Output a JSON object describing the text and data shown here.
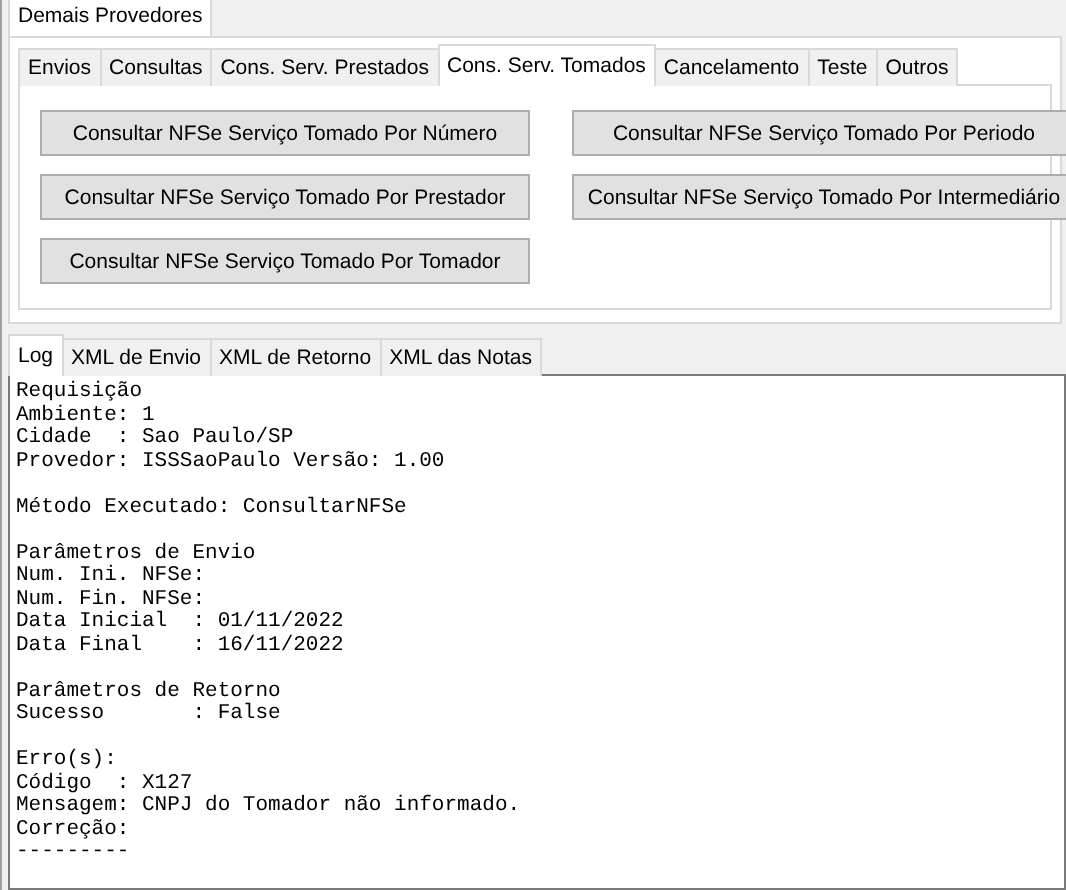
{
  "outer_tabs": [
    {
      "label": "Demais Provedores",
      "selected": true
    }
  ],
  "tabs": [
    {
      "label": "Envios",
      "selected": false
    },
    {
      "label": "Consultas",
      "selected": false
    },
    {
      "label": "Cons. Serv. Prestados",
      "selected": false
    },
    {
      "label": "Cons. Serv. Tomados",
      "selected": true
    },
    {
      "label": "Cancelamento",
      "selected": false
    },
    {
      "label": "Teste",
      "selected": false
    },
    {
      "label": "Outros",
      "selected": false
    }
  ],
  "buttons": [
    "Consultar NFSe Serviço Tomado Por Número",
    "Consultar NFSe Serviço Tomado Por Periodo",
    "Consultar NFSe Serviço Tomado Por Prestador",
    "Consultar NFSe Serviço Tomado Por Intermediário",
    "Consultar NFSe Serviço Tomado Por Tomador"
  ],
  "log_tabs": [
    {
      "label": "Log",
      "selected": true
    },
    {
      "label": "XML de Envio",
      "selected": false
    },
    {
      "label": "XML de Retorno",
      "selected": false
    },
    {
      "label": "XML das Notas",
      "selected": false
    }
  ],
  "log": [
    [
      "Requisição",
      "Ambiente: 1",
      "Cidade  : Sao Paulo/SP",
      "Provedor: ISSSaoPaulo Versão: 1.00"
    ],
    [
      "Método Executado: ConsultarNFSe"
    ],
    [
      "Parâmetros de Envio",
      "Num. Ini. NFSe:",
      "Num. Fin. NFSe:",
      "Data Inicial  : 01/11/2022",
      "Data Final    : 16/11/2022"
    ],
    [
      "Parâmetros de Retorno",
      "Sucesso       : False"
    ],
    [
      "Erro(s):",
      "Código  : X127",
      "Mensagem: CNPJ do Tomador não informado.",
      "Correção:",
      "---------"
    ]
  ]
}
